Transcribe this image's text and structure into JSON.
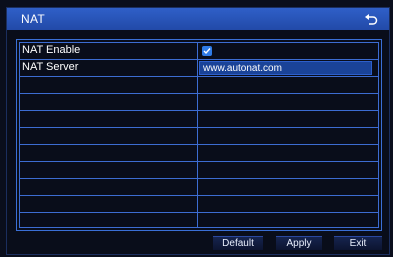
{
  "window": {
    "title": "NAT"
  },
  "rows": [
    {
      "label": "NAT Enable"
    },
    {
      "label": "NAT Server",
      "value": "www.autonat.com"
    }
  ],
  "nat_enable_checked": true,
  "buttons": {
    "default": "Default",
    "apply": "Apply",
    "exit": "Exit"
  }
}
